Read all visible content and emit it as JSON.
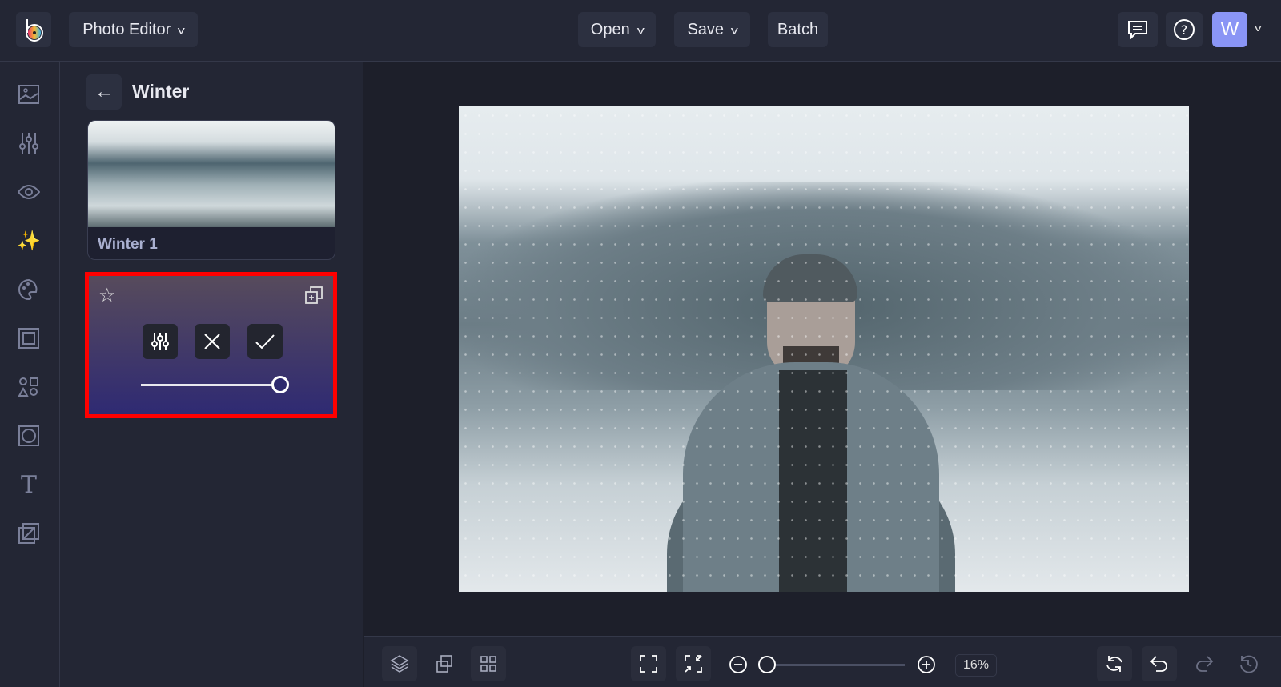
{
  "header": {
    "app_switcher": "Photo Editor",
    "open": "Open",
    "save": "Save",
    "batch": "Batch",
    "avatar_initial": "W"
  },
  "panel": {
    "title": "Winter",
    "preset_name": "Winter 1",
    "intensity_percent": 100
  },
  "zoom": {
    "value": "16%",
    "slider_fraction": 0.0
  },
  "colors": {
    "accent": "#8a95f5",
    "highlight": "#ff0000"
  }
}
